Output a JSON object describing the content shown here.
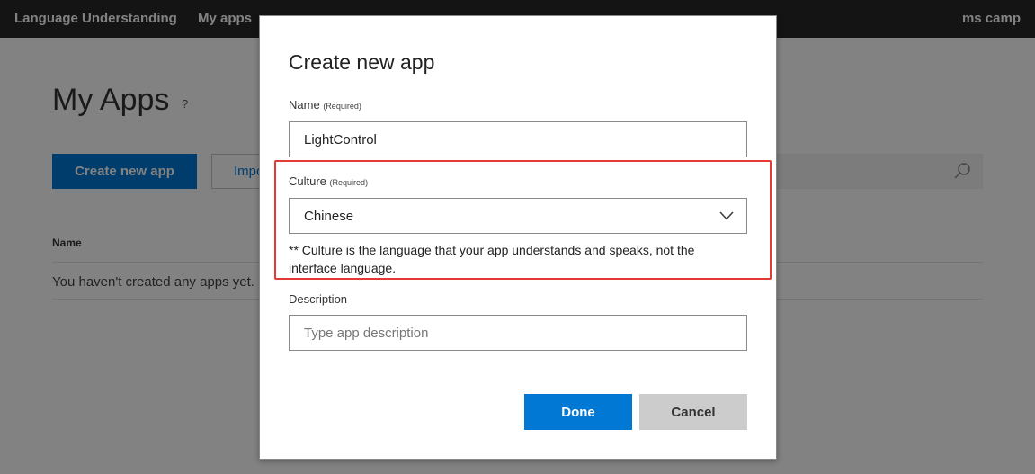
{
  "topbar": {
    "brand": "Language Understanding",
    "nav_my_apps": "My apps",
    "user": "ms camp"
  },
  "page": {
    "title": "My Apps",
    "help": "?",
    "create_button": "Create new app",
    "import_button": "Import new app",
    "column_name": "Name",
    "empty_text": "You haven't created any apps yet."
  },
  "dialog": {
    "title": "Create new app",
    "name": {
      "label": "Name",
      "required": "(Required)",
      "value": "LightControl"
    },
    "culture": {
      "label": "Culture",
      "required": "(Required)",
      "value": "Chinese",
      "note": "** Culture is the language that your app understands and speaks, not the interface language."
    },
    "description": {
      "label": "Description",
      "value": "",
      "placeholder": "Type app description"
    },
    "done_label": "Done",
    "cancel_label": "Cancel"
  },
  "colors": {
    "accent": "#0078d4",
    "highlight": "#e53935",
    "topbar": "#292929",
    "cancel_bg": "#cccccc"
  }
}
